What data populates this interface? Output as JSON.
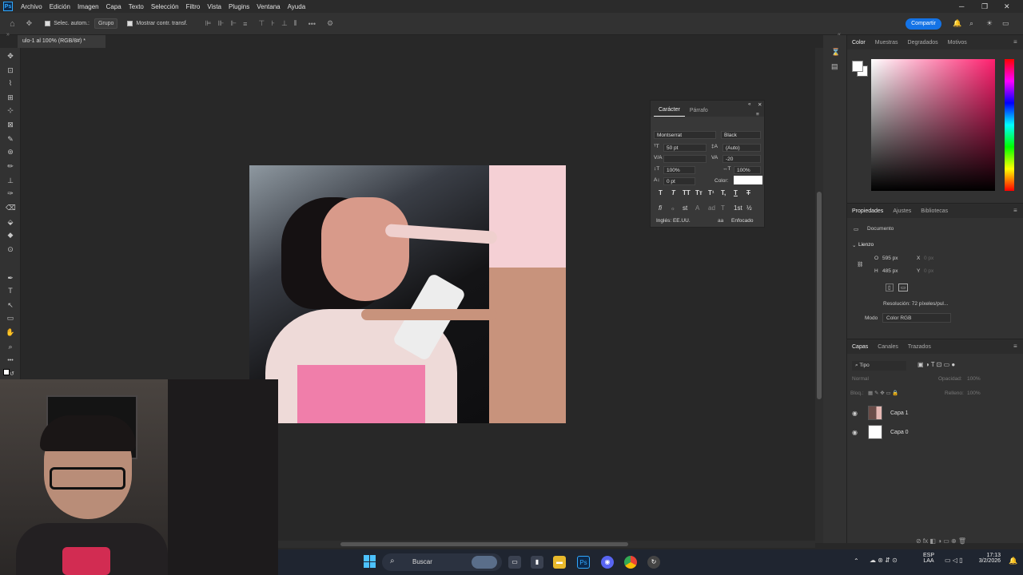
{
  "app": {
    "logo": "Ps"
  },
  "menu": [
    "Archivo",
    "Edición",
    "Imagen",
    "Capa",
    "Texto",
    "Selección",
    "Filtro",
    "Vista",
    "Plugins",
    "Ventana",
    "Ayuda"
  ],
  "options": {
    "auto_select_label": "Selec. autom.:",
    "auto_select_value": "Grupo",
    "show_transform_label": "Mostrar contr. transf.",
    "more": "•••",
    "share_label": "Compartir"
  },
  "document": {
    "tab_title": "ulo-1 al 100% (RGB/8#) *"
  },
  "character_panel": {
    "tabs": [
      "Carácter",
      "Párrafo"
    ],
    "font_family": "Montserrat",
    "font_style": "Black",
    "font_size": "50 pt",
    "leading": "(Auto)",
    "tracking": "-20",
    "vertical_scale": "100%",
    "horizontal_scale": "100%",
    "baseline_shift": "0 pt",
    "color_label": "Color:",
    "style_buttons": [
      "T",
      "T",
      "TT",
      "Tт",
      "T¹",
      "T,",
      "T",
      "T"
    ],
    "opentype_buttons": [
      "fi",
      "ℴ",
      "st",
      "A",
      "ad",
      "T",
      "1st",
      "½"
    ],
    "language": "Inglés: EE.UU.",
    "aa_label": "aa",
    "antialias": "Enfocado"
  },
  "color_panel": {
    "tabs": [
      "Color",
      "Muestras",
      "Degradados",
      "Motivos"
    ],
    "fg_color": "#ffffff",
    "bg_color": "#ffffff"
  },
  "properties_panel": {
    "tabs": [
      "Propiedades",
      "Ajustes",
      "Bibliotecas"
    ],
    "doc_label": "Documento",
    "canvas_label": "Lienzo",
    "width_label": "O",
    "width_value": "595 px",
    "height_label": "H",
    "height_value": "485 px",
    "x_label": "X",
    "x_value": "0 px",
    "y_label": "Y",
    "y_value": "0 px",
    "resolution": "Resolución: 72 píxeles/pul...",
    "mode_label": "Modo",
    "mode_value": "Color RGB"
  },
  "layers_panel": {
    "tabs": [
      "Capas",
      "Canales",
      "Trazados"
    ],
    "filter_label": "Tipo",
    "blend_mode": "Normal",
    "opacity_label": "Opacidad:",
    "opacity_value": "100%",
    "lock_label": "Bloq.:",
    "fill_label": "Relleno:",
    "fill_value": "100%",
    "layers": [
      {
        "name": "Capa 1"
      },
      {
        "name": "Capa 0"
      }
    ],
    "bottom_icons": "⊘  fx  ◧  ◑  ▭  ⊕  🗑"
  },
  "taskbar": {
    "search_label": "Buscar",
    "lang_top": "ESP",
    "lang_bottom": "LAA",
    "time": "17:13",
    "date": "3/2/2026",
    "apps": [
      "files",
      "ps",
      "discord",
      "chrome",
      "app"
    ]
  },
  "toolbar": {
    "tools": [
      "move-tool",
      "artboard-tool",
      "lasso-tool",
      "quick-select-tool",
      "crop-tool",
      "frame-tool",
      "eyedropper-tool",
      "healing-tool",
      "brush-tool",
      "stamp-tool",
      "history-brush-tool",
      "eraser-tool",
      "bucket-tool",
      "blur-tool",
      "dodge-tool",
      "pen-tool",
      "type-tool",
      "path-select-tool",
      "rectangle-tool",
      "hand-tool",
      "zoom-tool",
      "more-tools"
    ],
    "glyphs": [
      "✥",
      "⊡",
      "⌇",
      "⊞",
      "⊹",
      "⊠",
      "✎",
      "⊛",
      "✏",
      "⊥",
      "✑",
      "⌫",
      "⬙",
      "◆",
      "⊙",
      "✒",
      "T",
      "↖",
      "▭",
      "✋",
      "⌕",
      "•••"
    ]
  }
}
